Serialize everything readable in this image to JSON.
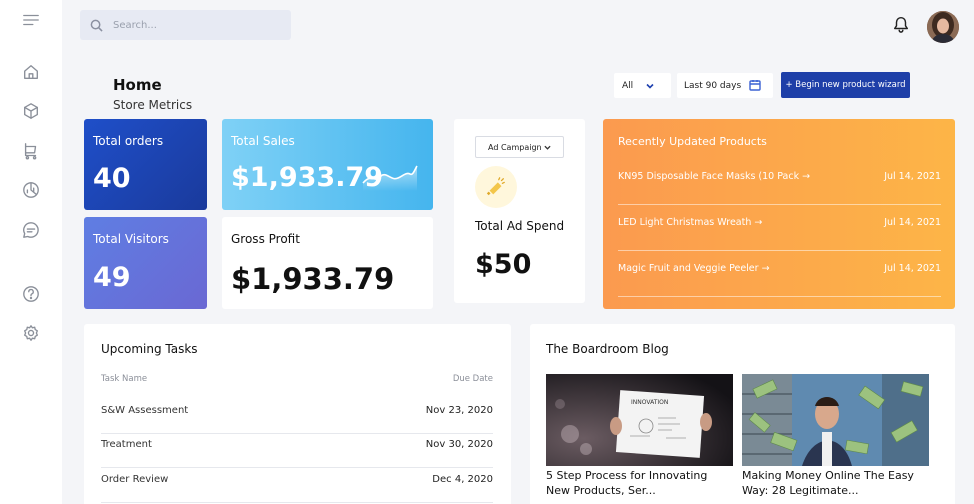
{
  "search": {
    "placeholder": "Search..."
  },
  "header": {
    "title": "Home",
    "subtitle": "Store Metrics"
  },
  "filters": {
    "segment": "All",
    "range": "Last 90 days",
    "wizard_label": "+ Begin new product wizard"
  },
  "metrics": {
    "orders": {
      "label": "Total orders",
      "value": "40"
    },
    "visitors": {
      "label": "Total Visitors",
      "value": "49"
    },
    "sales": {
      "label": "Total Sales",
      "value": "$1,933.79"
    },
    "profit": {
      "label": "Gross Profit",
      "value": "$1,933.79"
    }
  },
  "ad": {
    "select_label": "Ad Campaign",
    "label": "Total Ad Spend",
    "value": "$50"
  },
  "products": {
    "title": "Recently Updated Products",
    "items": [
      {
        "name": "KN95 Disposable Face Masks (10 Pack →",
        "date": "Jul 14, 2021"
      },
      {
        "name": "LED Light Christmas Wreath →",
        "date": "Jul 14, 2021"
      },
      {
        "name": "Magic Fruit and Veggie Peeler →",
        "date": "Jul 14, 2021"
      }
    ]
  },
  "tasks": {
    "title": "Upcoming Tasks",
    "col_name": "Task Name",
    "col_date": "Due Date",
    "rows": [
      {
        "name": "S&W Assessment",
        "date": "Nov 23, 2020"
      },
      {
        "name": "Treatment",
        "date": "Nov 30, 2020"
      },
      {
        "name": "Order Review",
        "date": "Dec 4, 2020"
      }
    ]
  },
  "blog": {
    "title": "The Boardroom Blog",
    "posts": [
      {
        "title": "5 Step Process for Innovating New Products, Ser...",
        "image_text": "INNOVATION"
      },
      {
        "title": "Making Money Online The Easy Way: 28 Legitimate..."
      }
    ]
  },
  "icons": {
    "sidebar": [
      "menu-icon",
      "home-icon",
      "box-icon",
      "cart-icon",
      "chart-icon",
      "chat-icon",
      "help-icon",
      "settings-icon"
    ],
    "accent": "#1e3fa8"
  }
}
